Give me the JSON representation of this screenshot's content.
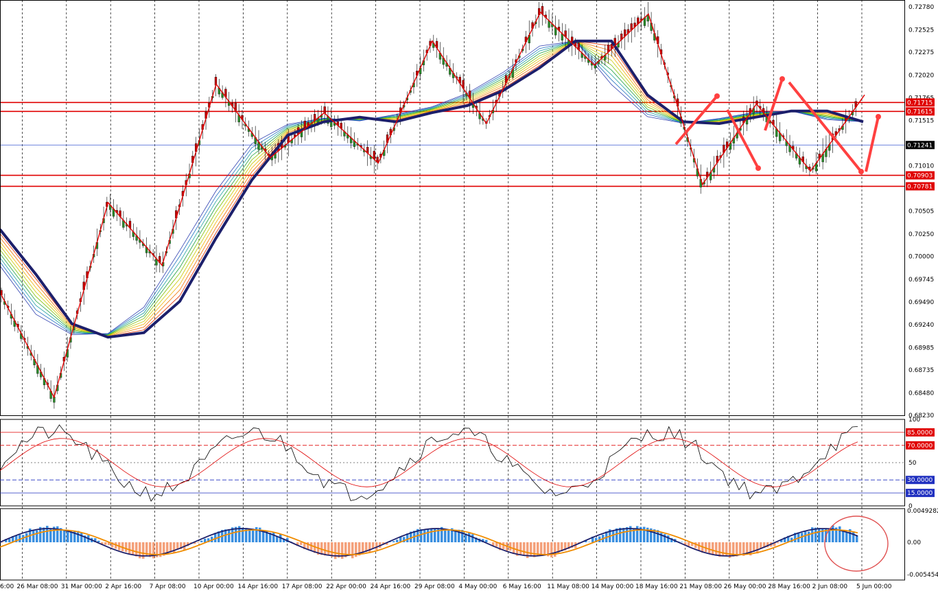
{
  "chart_data": {
    "type": "line",
    "price_axis": {
      "ticks": [
        "0.72780",
        "0.72525",
        "0.72275",
        "0.72020",
        "0.71765",
        "0.71515",
        "0.71010",
        "0.70505",
        "0.70250",
        "0.70000",
        "0.69745",
        "0.69490",
        "0.69240",
        "0.68985",
        "0.68735",
        "0.68480",
        "0.68230"
      ],
      "ylim": [
        0.6823,
        0.7278
      ]
    },
    "levels": [
      {
        "label": "0.71715",
        "value": 0.71715,
        "color": "#e00000"
      },
      {
        "label": "0.71615",
        "value": 0.71615,
        "color": "#e00000"
      },
      {
        "label": "0.71241",
        "value": 0.71241,
        "color": "#000000"
      },
      {
        "label": "0.70903",
        "value": 0.70903,
        "color": "#e00000"
      },
      {
        "label": "0.70781",
        "value": 0.70781,
        "color": "#e00000"
      }
    ],
    "time_axis": [
      "6:00",
      "26 Mar 08:00",
      "31 Mar 00:00",
      "2 Apr 16:00",
      "7 Apr 08:00",
      "10 Apr 00:00",
      "14 Apr 16:00",
      "17 Apr 08:00",
      "22 Apr 00:00",
      "24 Apr 16:00",
      "29 Apr 08:00",
      "4 May 00:00",
      "6 May 16:00",
      "11 May 08:00",
      "14 May 00:00",
      "18 May 16:00",
      "21 May 08:00",
      "26 May 00:00",
      "28 May 16:00",
      "2 Jun 08:00",
      "5 Jun 00:00"
    ],
    "zigzag_prices": [
      0.696,
      0.6843,
      0.706,
      0.699,
      0.7192,
      0.711,
      0.716,
      0.7104,
      0.724,
      0.7148,
      0.7272,
      0.7213,
      0.727,
      0.708,
      0.717,
      0.7095,
      0.718
    ],
    "ma_prices": [
      0.703,
      0.698,
      0.6925,
      0.691,
      0.6915,
      0.695,
      0.702,
      0.7085,
      0.7135,
      0.715,
      0.7155,
      0.715,
      0.716,
      0.7168,
      0.7185,
      0.721,
      0.724,
      0.724,
      0.718,
      0.715,
      0.7148,
      0.7155,
      0.7162,
      0.7162,
      0.715
    ],
    "stoch_axis": [
      "100",
      "85.0000",
      "70.0000",
      "50",
      "30.0000",
      "15.0000",
      "0"
    ],
    "macd_axis": [
      "0.0049282",
      "0.00",
      "-0.005454"
    ]
  }
}
